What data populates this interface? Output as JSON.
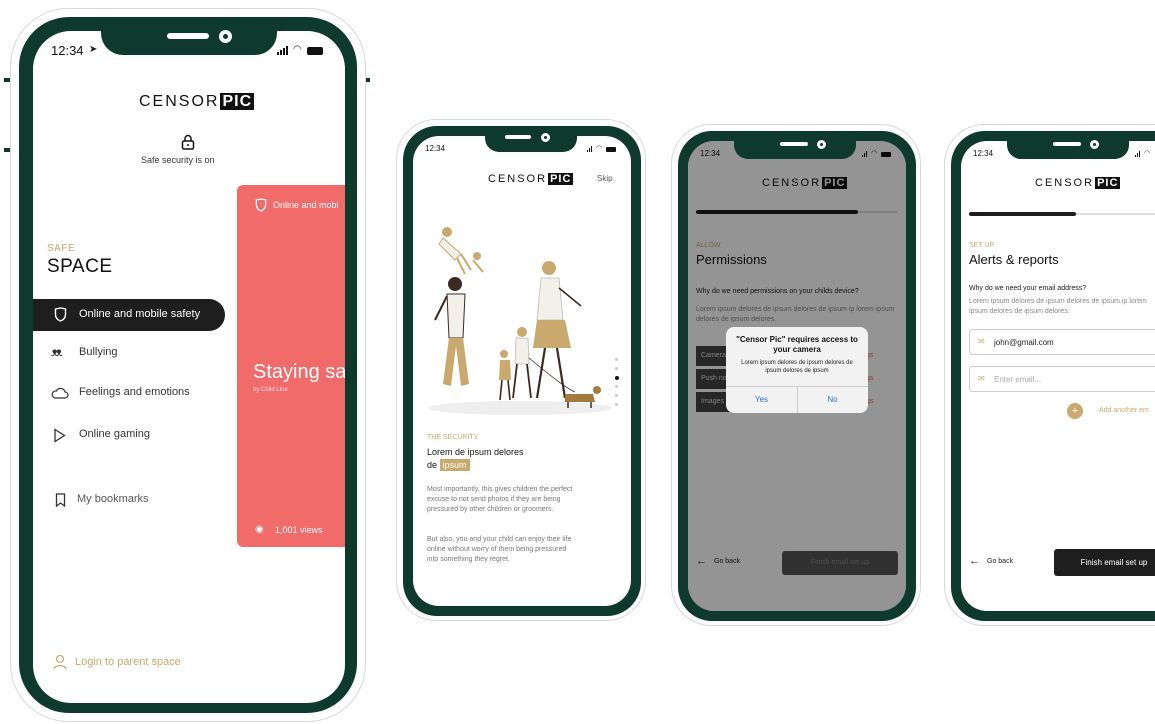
{
  "status": {
    "time": "12:34"
  },
  "brand": {
    "logo_left": "CENSOR",
    "logo_right": "PIC"
  },
  "screen1": {
    "security_status": "Safe security is on",
    "section_eyebrow": "SAFE",
    "section_title": "SPACE",
    "menu": [
      {
        "label": "Online and mobile safety",
        "icon": "shield-icon",
        "active": true
      },
      {
        "label": "Bullying",
        "icon": "people-icon",
        "active": false
      },
      {
        "label": "Feelings and emotions",
        "icon": "cloud-icon",
        "active": false
      },
      {
        "label": "Online gaming",
        "icon": "play-icon",
        "active": false
      }
    ],
    "bookmarks_label": "My bookmarks",
    "login_label": "Login to parent space",
    "card": {
      "tag": "Online and mobi",
      "headline": "Staying sa",
      "byline": "by Child Line",
      "views": "1,001 views"
    }
  },
  "screen2": {
    "skip": "Skip",
    "eyebrow": "THE SECURITY",
    "heading_line1": "Lorem de ipsum delores",
    "heading_line2_prefix": "de",
    "heading_highlight": "ipsum",
    "para1": "Most importantly, this gives children the perfect excuse to not send photos if they are being pressured by other children or groomers.",
    "para2": "But also, you and your child can enjoy their life online without worry of them being pressured into something they regret.",
    "page_dots": 6,
    "active_dot": 2
  },
  "screen3": {
    "progress": 0.8,
    "eyebrow": "ALLOW",
    "title": "Permissions",
    "question": "Why do we need permissions on your childs device?",
    "body": "Lorem ipsum delores de ipsum delores de ipsum ip lorem ipsum delores de ipsum delores.",
    "rows": [
      {
        "label": "Camera",
        "action": "Settings"
      },
      {
        "label": "Push notifications",
        "action": "Settings"
      },
      {
        "label": "Images",
        "action": "Settings"
      }
    ],
    "dialog": {
      "title": "\"Censor Pic\" requires access to your camera",
      "message": "Lorem ipsum delores de ipsum delores de ipsum delores de ipsum",
      "yes": "Yes",
      "no": "No"
    },
    "back": "Go back",
    "finish": "Finish email set up"
  },
  "screen4": {
    "progress": 0.5,
    "eyebrow": "SET UP",
    "title": "Alerts & reports",
    "question": "Why do we need your email address?",
    "body": "Lorem ipsum delores de ipsum delores de ipsum ip lorem ipsum delores de ipsum delores.",
    "email_value": "john@gmail.com",
    "email_placeholder": "Enter email...",
    "add_label": "Add another em",
    "back": "Go back",
    "finish": "Finish email set up"
  },
  "colors": {
    "bezel": "#0d3a2c",
    "gold": "#c9a96e",
    "coral": "#f26b6b",
    "dark_button": "#1e1e1e"
  }
}
